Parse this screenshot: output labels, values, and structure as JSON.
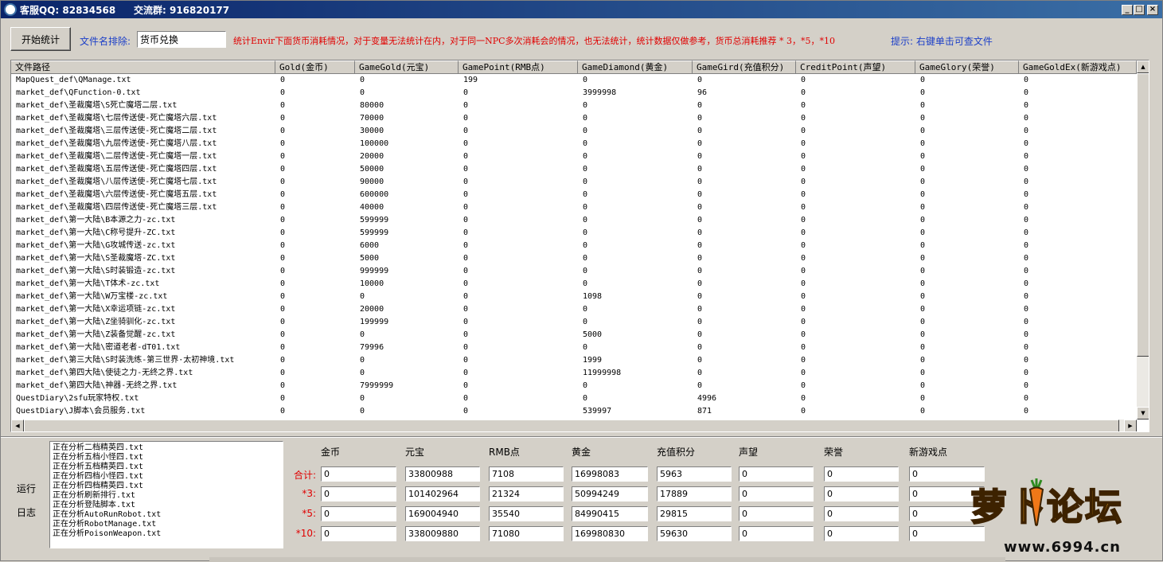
{
  "titlebar": {
    "qq": "客服QQ: 82834568",
    "group": "交流群: 916820177"
  },
  "toolbar": {
    "start_label": "开始统计",
    "filename_exclude_label": "文件名排除:",
    "filename_exclude_value": "货币兑换",
    "note": "统计Envir下面货币消耗情况，对于变量无法统计在内，对于同一NPC多次消耗会的情况，也无法统计，统计数据仅做参考，货币总消耗推荐 * 3，*5，*10",
    "hint": "提示: 右键单击可查文件"
  },
  "grid": {
    "columns": [
      "文件路径",
      "Gold(金币)",
      "GameGold(元宝)",
      "GamePoint(RMB点)",
      "GameDiamond(黄金)",
      "GameGird(充值积分)",
      "CreditPoint(声望)",
      "GameGlory(荣誉)",
      "GameGoldEx(新游戏点)"
    ],
    "rows": [
      [
        "MapQuest_def\\QManage.txt",
        "0",
        "0",
        "199",
        "0",
        "0",
        "0",
        "0",
        "0"
      ],
      [
        "market_def\\QFunction-0.txt",
        "0",
        "0",
        "0",
        "3999998",
        "96",
        "0",
        "0",
        "0"
      ],
      [
        "market_def\\圣裁魔塔\\S死亡魔塔二层.txt",
        "0",
        "80000",
        "0",
        "0",
        "0",
        "0",
        "0",
        "0"
      ],
      [
        "market_def\\圣裁魔塔\\七层传送使-死亡魔塔六层.txt",
        "0",
        "70000",
        "0",
        "0",
        "0",
        "0",
        "0",
        "0"
      ],
      [
        "market_def\\圣裁魔塔\\三层传送使-死亡魔塔二层.txt",
        "0",
        "30000",
        "0",
        "0",
        "0",
        "0",
        "0",
        "0"
      ],
      [
        "market_def\\圣裁魔塔\\九层传送使-死亡魔塔八层.txt",
        "0",
        "100000",
        "0",
        "0",
        "0",
        "0",
        "0",
        "0"
      ],
      [
        "market_def\\圣裁魔塔\\二层传送使-死亡魔塔一层.txt",
        "0",
        "20000",
        "0",
        "0",
        "0",
        "0",
        "0",
        "0"
      ],
      [
        "market_def\\圣裁魔塔\\五层传送使-死亡魔塔四层.txt",
        "0",
        "50000",
        "0",
        "0",
        "0",
        "0",
        "0",
        "0"
      ],
      [
        "market_def\\圣裁魔塔\\八层传送使-死亡魔塔七层.txt",
        "0",
        "90000",
        "0",
        "0",
        "0",
        "0",
        "0",
        "0"
      ],
      [
        "market_def\\圣裁魔塔\\六层传送使-死亡魔塔五层.txt",
        "0",
        "600000",
        "0",
        "0",
        "0",
        "0",
        "0",
        "0"
      ],
      [
        "market_def\\圣裁魔塔\\四层传送使-死亡魔塔三层.txt",
        "0",
        "40000",
        "0",
        "0",
        "0",
        "0",
        "0",
        "0"
      ],
      [
        "market_def\\第一大陆\\B本源之力-zc.txt",
        "0",
        "599999",
        "0",
        "0",
        "0",
        "0",
        "0",
        "0"
      ],
      [
        "market_def\\第一大陆\\C称号提升-ZC.txt",
        "0",
        "599999",
        "0",
        "0",
        "0",
        "0",
        "0",
        "0"
      ],
      [
        "market_def\\第一大陆\\G攻城传送-zc.txt",
        "0",
        "6000",
        "0",
        "0",
        "0",
        "0",
        "0",
        "0"
      ],
      [
        "market_def\\第一大陆\\S圣裁魔塔-ZC.txt",
        "0",
        "5000",
        "0",
        "0",
        "0",
        "0",
        "0",
        "0"
      ],
      [
        "market_def\\第一大陆\\S时装锻造-zc.txt",
        "0",
        "999999",
        "0",
        "0",
        "0",
        "0",
        "0",
        "0"
      ],
      [
        "market_def\\第一大陆\\T体术-zc.txt",
        "0",
        "10000",
        "0",
        "0",
        "0",
        "0",
        "0",
        "0"
      ],
      [
        "market_def\\第一大陆\\W万宝楼-zc.txt",
        "0",
        "0",
        "0",
        "1098",
        "0",
        "0",
        "0",
        "0"
      ],
      [
        "market_def\\第一大陆\\X幸运项链-zc.txt",
        "0",
        "20000",
        "0",
        "0",
        "0",
        "0",
        "0",
        "0"
      ],
      [
        "market_def\\第一大陆\\Z坐骑驯化-zc.txt",
        "0",
        "199999",
        "0",
        "0",
        "0",
        "0",
        "0",
        "0"
      ],
      [
        "market_def\\第一大陆\\Z装备觉醒-zc.txt",
        "0",
        "0",
        "0",
        "5000",
        "0",
        "0",
        "0",
        "0"
      ],
      [
        "market_def\\第一大陆\\密道老者-dT01.txt",
        "0",
        "79996",
        "0",
        "0",
        "0",
        "0",
        "0",
        "0"
      ],
      [
        "market_def\\第三大陆\\S时装洗练-第三世界·太初神境.txt",
        "0",
        "0",
        "0",
        "1999",
        "0",
        "0",
        "0",
        "0"
      ],
      [
        "market_def\\第四大陆\\使徒之力-无终之界.txt",
        "0",
        "0",
        "0",
        "11999998",
        "0",
        "0",
        "0",
        "0"
      ],
      [
        "market_def\\第四大陆\\神器-无终之界.txt",
        "0",
        "7999999",
        "0",
        "0",
        "0",
        "0",
        "0",
        "0"
      ],
      [
        "QuestDiary\\2sfu玩家特权.txt",
        "0",
        "0",
        "0",
        "0",
        "4996",
        "0",
        "0",
        "0"
      ],
      [
        "QuestDiary\\J脚本\\会员服务.txt",
        "0",
        "0",
        "0",
        "539997",
        "871",
        "0",
        "0",
        "0"
      ]
    ]
  },
  "log": {
    "run_label": "运行",
    "log_label": "日志",
    "lines": [
      "正在分析二档精英四.txt",
      "正在分析五档小怪四.txt",
      "正在分析五档精英四.txt",
      "正在分析四档小怪四.txt",
      "正在分析四档精英四.txt",
      "正在分析刷新排行.txt",
      "正在分析登陆脚本.txt",
      "正在分析AutoRunRobot.txt",
      "正在分析RobotManage.txt",
      "正在分析PoisonWeapon.txt"
    ]
  },
  "summary": {
    "headers": [
      "金币",
      "元宝",
      "RMB点",
      "黄金",
      "充值积分",
      "声望",
      "荣誉",
      "新游戏点"
    ],
    "rows": [
      {
        "label": "合计:",
        "values": [
          "0",
          "33800988",
          "7108",
          "16998083",
          "5963",
          "0",
          "0",
          "0"
        ]
      },
      {
        "label": "*3:",
        "values": [
          "0",
          "101402964",
          "21324",
          "50994249",
          "17889",
          "0",
          "0",
          "0"
        ]
      },
      {
        "label": "*5:",
        "values": [
          "0",
          "169004940",
          "35540",
          "84990415",
          "29815",
          "0",
          "0",
          "0"
        ]
      },
      {
        "label": "*10:",
        "values": [
          "0",
          "338009880",
          "71080",
          "169980830",
          "59630",
          "0",
          "0",
          "0"
        ]
      }
    ]
  },
  "watermark": {
    "text": "萝卜论坛",
    "url": "www.6994.cn"
  }
}
